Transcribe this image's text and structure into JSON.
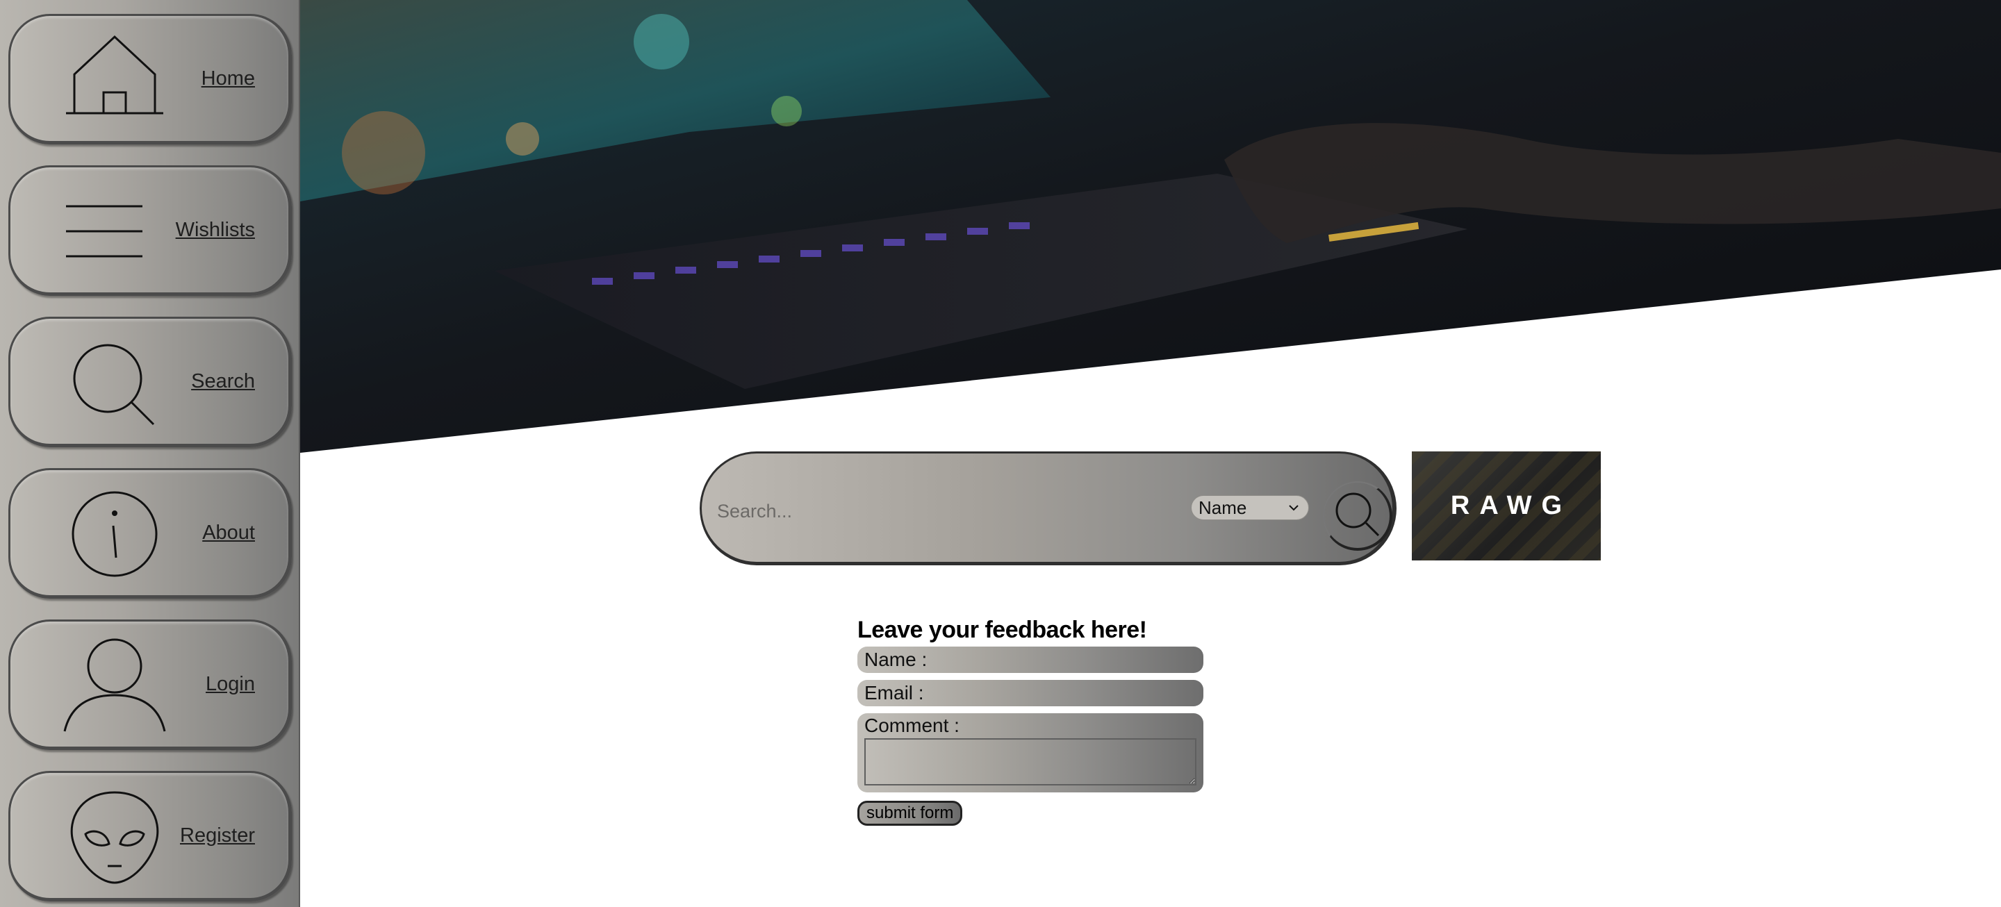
{
  "sidebar": {
    "items": [
      {
        "label": "Home",
        "icon": "home-icon"
      },
      {
        "label": "Wishlists",
        "icon": "menu-icon"
      },
      {
        "label": "Search",
        "icon": "search-icon"
      },
      {
        "label": "About",
        "icon": "info-icon"
      },
      {
        "label": "Login",
        "icon": "user-icon"
      },
      {
        "label": "Register",
        "icon": "alien-icon"
      }
    ]
  },
  "search": {
    "placeholder": "Search...",
    "filter_selected": "Name"
  },
  "logo": {
    "text": "RAWG"
  },
  "feedback": {
    "title": "Leave your feedback here!",
    "name_label": "Name :",
    "email_label": "Email :",
    "comment_label": "Comment :",
    "submit_label": "submit form"
  },
  "colors": {
    "sidebar_gradient_start": "#b9b6b0",
    "sidebar_gradient_end": "#7b7b7a",
    "text": "#1e1e1e"
  }
}
